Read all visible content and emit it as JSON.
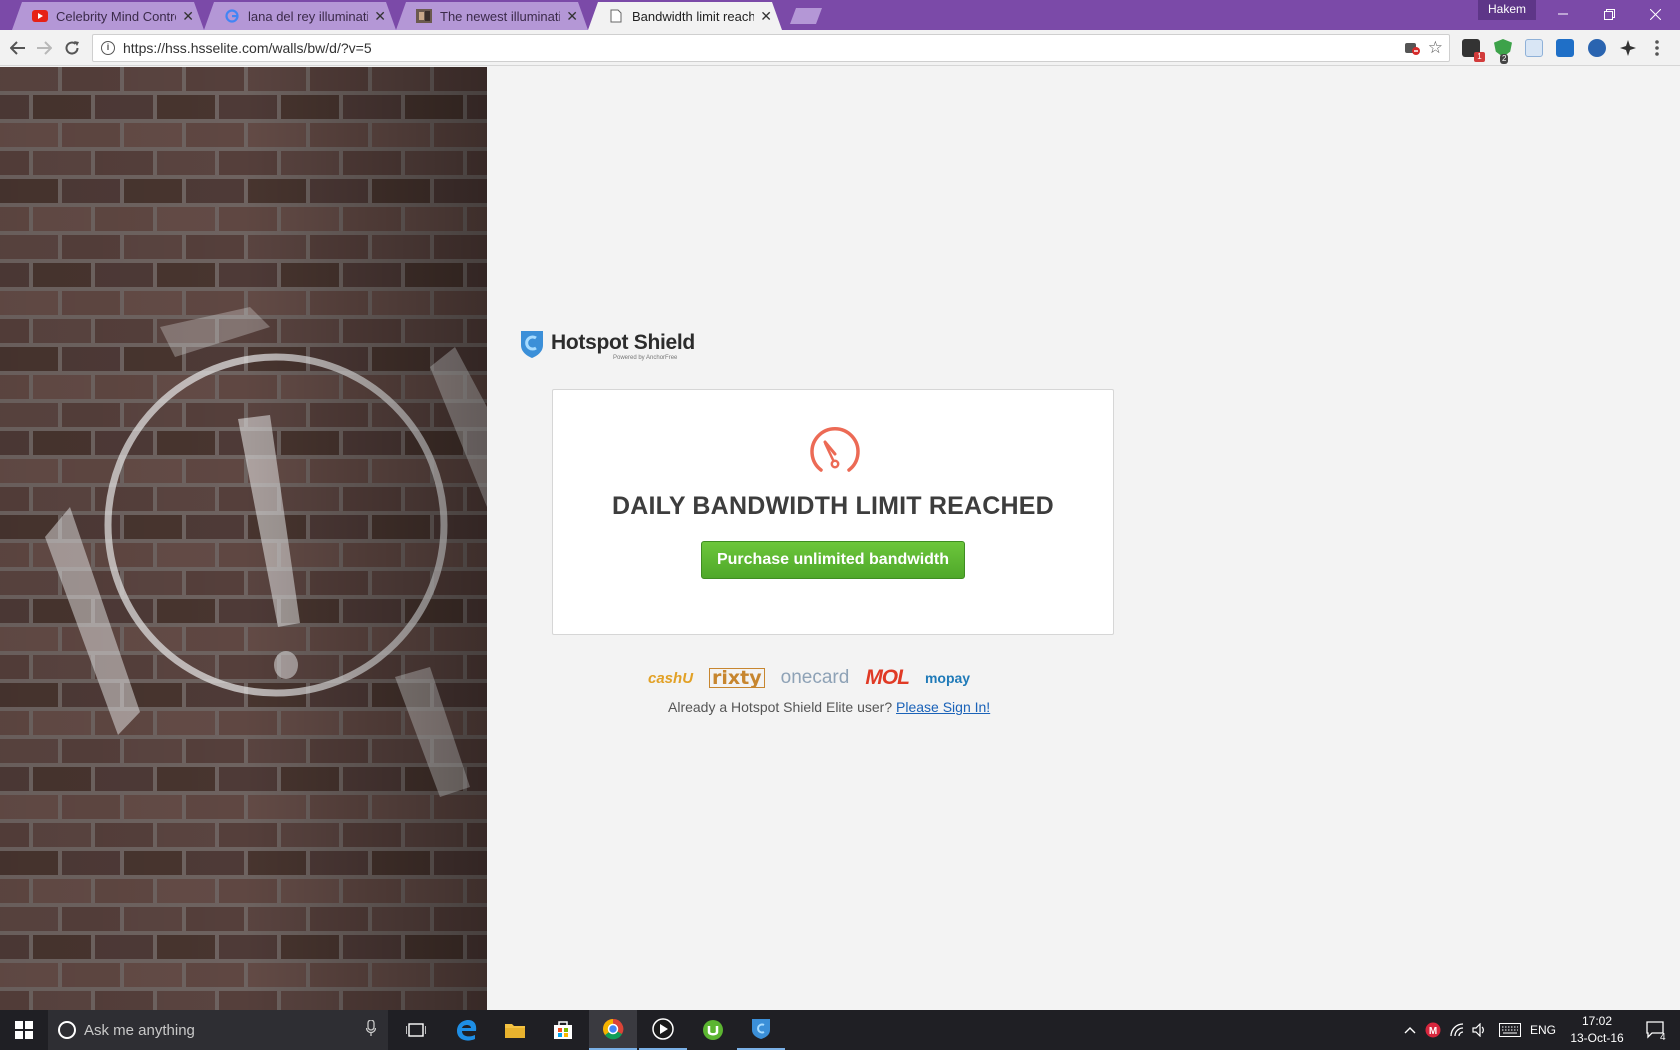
{
  "browser": {
    "tabs": [
      {
        "title": "Celebrity Mind Control S",
        "favicon": "youtube-icon",
        "active": false
      },
      {
        "title": "lana del rey illuminati - G",
        "favicon": "google-icon",
        "active": false
      },
      {
        "title": "The newest illuminati pu",
        "favicon": "image-thumb-icon",
        "active": false
      },
      {
        "title": "Bandwidth limit reached",
        "favicon": "page-icon",
        "active": true
      }
    ],
    "profile_name": "Hakem",
    "url": "https://hss.hsselite.com/walls/bw/d/?v=5",
    "extension_badges": {
      "ext1": "1",
      "ext2": "2"
    }
  },
  "page": {
    "brand": "Hotspot Shield",
    "powered_by": "Powered by AnchorFree",
    "heading": "DAILY BANDWIDTH LIMIT REACHED",
    "purchase_button": "Purchase unlimited bandwidth",
    "payment_methods": [
      "cashU",
      "rixty",
      "onecard",
      "MOL",
      "mopay"
    ],
    "signin_prompt": "Already a Hotspot Shield Elite user?",
    "signin_link": "Please Sign In!"
  },
  "taskbar": {
    "search_placeholder": "Ask me anything",
    "language": "ENG",
    "time": "17:02",
    "date": "13-Oct-16",
    "notification_count": "4"
  },
  "colors": {
    "titlebar": "#7b4aa8",
    "accent_green": "#5cb531",
    "gauge_coral": "#ec6a55",
    "brick": "#5a4440"
  }
}
